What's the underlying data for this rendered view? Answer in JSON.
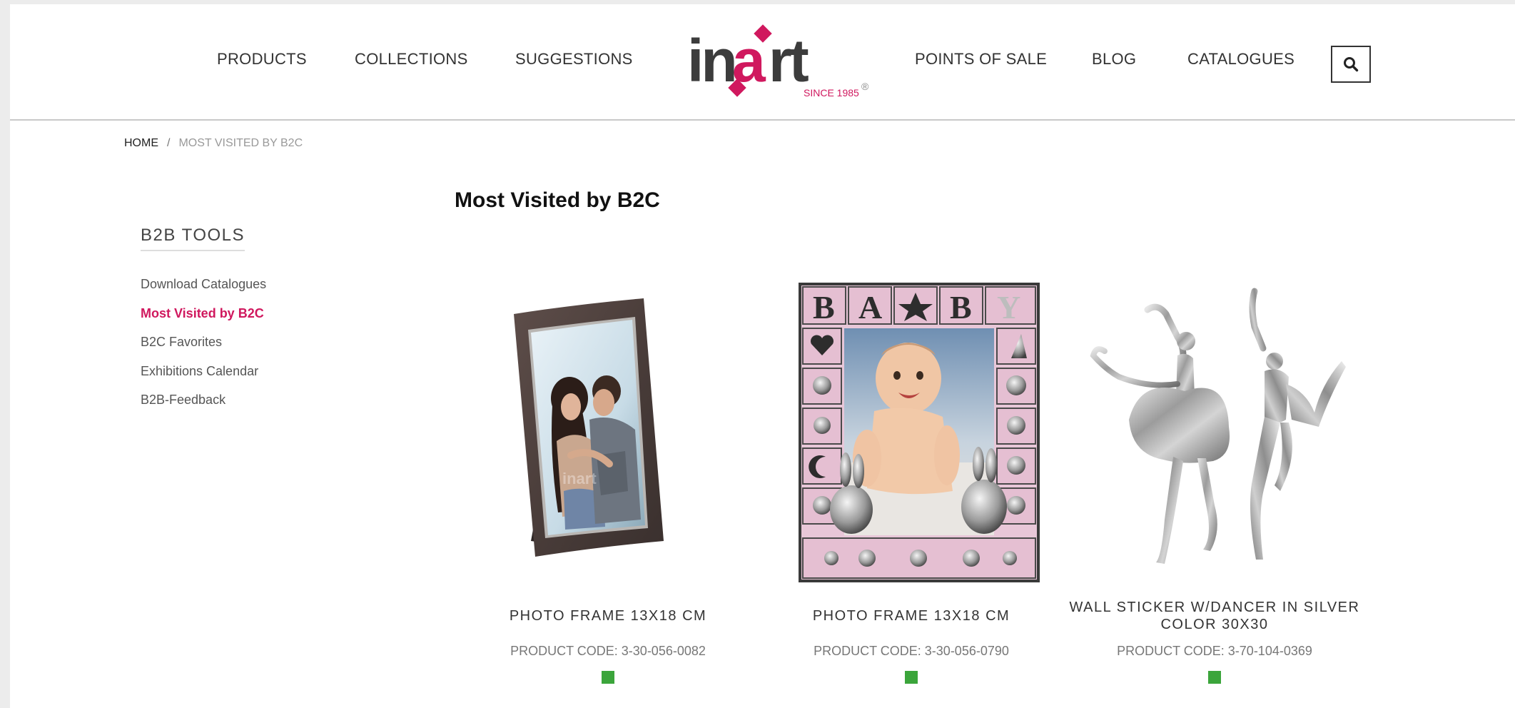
{
  "header": {
    "nav_left": [
      "PRODUCTS",
      "COLLECTIONS",
      "SUGGESTIONS"
    ],
    "nav_right": [
      "POINTS OF SALE",
      "BLOG",
      "CATALOGUES"
    ],
    "logo": {
      "wordmark": "inart",
      "tagline": "SINCE 1985",
      "registered": "®",
      "accent_color": "#d0185e",
      "text_color": "#3c3c3c"
    },
    "search_icon": "search-icon"
  },
  "breadcrumb": {
    "home": "HOME",
    "separator": "/",
    "current": "MOST VISITED BY B2C"
  },
  "sidebar": {
    "title": "B2B TOOLS",
    "items": [
      {
        "label": "Download Catalogues",
        "active": false
      },
      {
        "label": "Most Visited by B2C",
        "active": true
      },
      {
        "label": "B2C Favorites",
        "active": false
      },
      {
        "label": "Exhibitions Calendar",
        "active": false
      },
      {
        "label": "B2B-Feedback",
        "active": false
      }
    ],
    "active_color": "#d0185e"
  },
  "main": {
    "title": "Most Visited by B2C",
    "products": [
      {
        "name": "PHOTO FRAME 13X18 CM",
        "code": "PRODUCT CODE: 3-30-056-0082",
        "in_stock": true
      },
      {
        "name": "PHOTO FRAME 13X18 CM",
        "code": "PRODUCT CODE: 3-30-056-0790",
        "in_stock": true
      },
      {
        "name": "WALL STICKER W/DANCER IN SILVER COLOR 30X30",
        "code": "PRODUCT CODE: 3-70-104-0369",
        "in_stock": true
      }
    ],
    "stock_color": "#3ba53b"
  }
}
